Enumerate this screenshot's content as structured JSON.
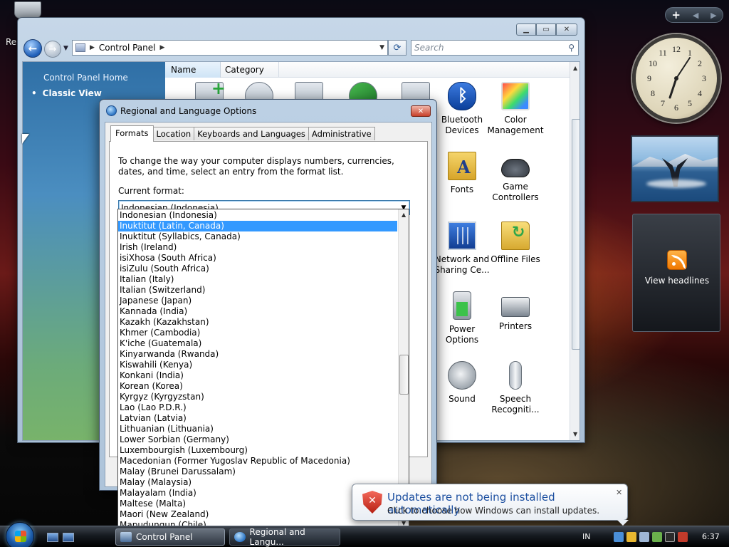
{
  "desktop": {
    "recycle_label": "Re"
  },
  "sidebar": {
    "feed_label": "View headlines",
    "clock_time": "6:37"
  },
  "control_panel": {
    "address": "Control Panel",
    "search_placeholder": "Search",
    "nav": {
      "home": "Control Panel Home",
      "classic": "Classic View"
    },
    "columns": [
      "Name",
      "Category"
    ],
    "items": [
      {
        "label": "Bluetooth Devices",
        "icon": "bluetooth-icon"
      },
      {
        "label": "Color Management",
        "icon": "color-management-icon"
      },
      {
        "label": "Fonts",
        "icon": "fonts-folder-icon"
      },
      {
        "label": "Game Controllers",
        "icon": "gamepad-icon"
      },
      {
        "label": "Network and Sharing Ce...",
        "icon": "network-icon"
      },
      {
        "label": "Offline Files",
        "icon": "offline-files-icon"
      },
      {
        "label": "Power Options",
        "icon": "battery-plug-icon"
      },
      {
        "label": "Printers",
        "icon": "printer-icon"
      },
      {
        "label": "Sound",
        "icon": "speaker-icon"
      },
      {
        "label": "Speech Recogniti...",
        "icon": "microphone-icon"
      }
    ]
  },
  "dialog": {
    "title": "Regional and Language Options",
    "tabs": [
      "Formats",
      "Location",
      "Keyboards and Languages",
      "Administrative"
    ],
    "active_tab": "Formats",
    "intro": "To change the way your computer displays numbers, currencies, dates, and time, select an entry from the format list.",
    "current_format_label": "Current format:",
    "current_format": "Indonesian (Indonesia)",
    "options": [
      "Indonesian (Indonesia)",
      "Inuktitut (Latin, Canada)",
      "Inuktitut (Syllabics, Canada)",
      "Irish (Ireland)",
      "isiXhosa (South Africa)",
      "isiZulu (South Africa)",
      "Italian (Italy)",
      "Italian (Switzerland)",
      "Japanese (Japan)",
      "Kannada (India)",
      "Kazakh (Kazakhstan)",
      "Khmer (Cambodia)",
      "K'iche (Guatemala)",
      "Kinyarwanda (Rwanda)",
      "Kiswahili (Kenya)",
      "Konkani (India)",
      "Korean (Korea)",
      "Kyrgyz (Kyrgyzstan)",
      "Lao (Lao P.D.R.)",
      "Latvian (Latvia)",
      "Lithuanian (Lithuania)",
      "Lower Sorbian (Germany)",
      "Luxembourgish (Luxembourg)",
      "Macedonian (Former Yugoslav Republic of Macedonia)",
      "Malay (Brunei Darussalam)",
      "Malay (Malaysia)",
      "Malayalam (India)",
      "Maltese (Malta)",
      "Maori (New Zealand)",
      "Mapudungun (Chile)"
    ],
    "highlighted_option": "Inuktitut (Latin, Canada)"
  },
  "notification": {
    "title": "Updates are not being installed automatically",
    "text": "Click to choose how Windows can install updates."
  },
  "taskbar": {
    "buttons": [
      "Control Panel",
      "Regional and Langu..."
    ],
    "language": "IN",
    "time": "6:37"
  },
  "colors": {
    "selection": "#3399ff",
    "nav_pane_top": "#2f6fa6",
    "balloon_title": "#1c4fa0"
  }
}
